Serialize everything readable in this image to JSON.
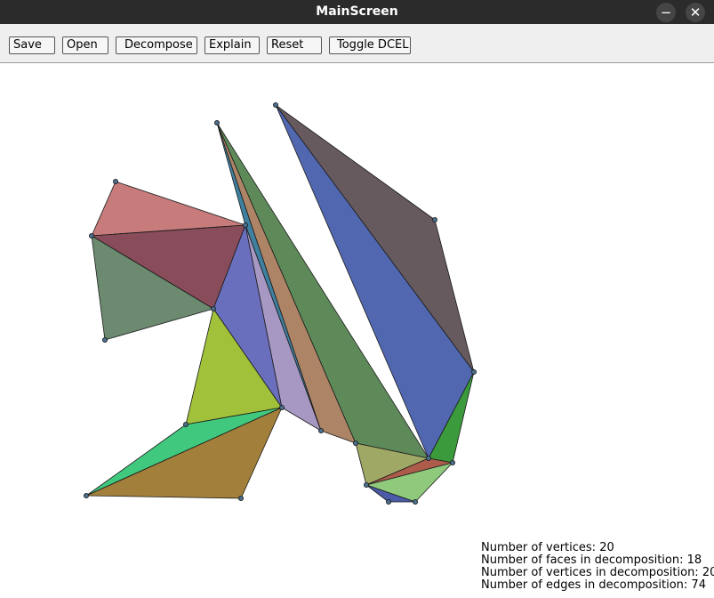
{
  "window": {
    "title": "MainScreen",
    "minimize_glyph": "−",
    "close_glyph": "✕"
  },
  "toolbar": {
    "buttons": [
      {
        "id": "save",
        "label": "Save"
      },
      {
        "id": "open",
        "label": "Open"
      },
      {
        "id": "decompose",
        "label": "Decompose"
      },
      {
        "id": "explain",
        "label": "Explain"
      },
      {
        "id": "reset",
        "label": "Reset"
      },
      {
        "id": "toggle_dcel",
        "label": "Toggle DCEL"
      }
    ]
  },
  "stats": {
    "vertices": "Number of vertices: 20",
    "faces": "Number of faces in decomposition: 18",
    "decomp_vertices": "Number of vertices in decomposition: 20",
    "decomp_edges": "Number of edges in decomposition: 74"
  },
  "colors": {
    "vertex_fill": "#4a6e8c",
    "edge_stroke": "#1a1a1a",
    "face_colors": [
      "#c77b7b",
      "#884c5a",
      "#6c8a70",
      "#6a6fbd",
      "#a2c13a",
      "#a698c2",
      "#3f80a0",
      "#ad8466",
      "#5e8a5a",
      "#665a5e",
      "#5168b0",
      "#3a9a3c",
      "#41c87f",
      "#a27f3a",
      "#a0a865",
      "#ad5c4c",
      "#8ec97c",
      "#4b5ba8"
    ]
  }
}
